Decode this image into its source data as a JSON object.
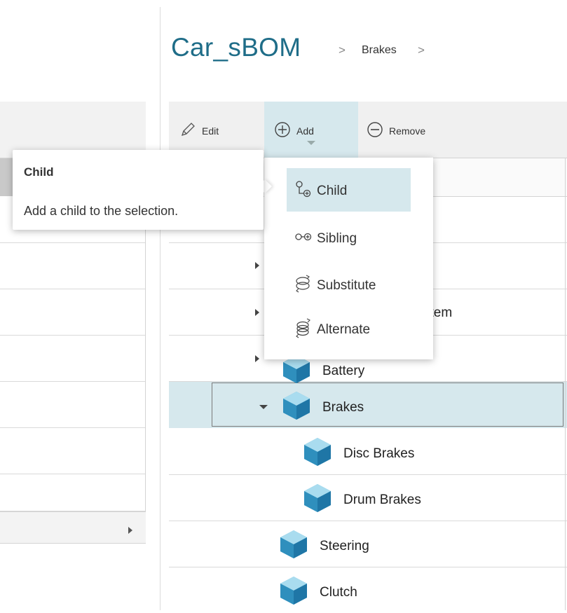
{
  "breadcrumb": {
    "root": "Car_sBOM",
    "separator": ">",
    "current": "Brakes"
  },
  "toolbar": {
    "edit_label": "Edit",
    "add_label": "Add",
    "remove_label": "Remove"
  },
  "tooltip": {
    "title": "Child",
    "description": "Add a child to the selection."
  },
  "add_menu": {
    "items": [
      {
        "label": "Child",
        "icon": "child-structure-icon",
        "highlighted": true
      },
      {
        "label": "Sibling",
        "icon": "sibling-structure-icon"
      },
      {
        "label": "Substitute",
        "icon": "substitute-icon"
      },
      {
        "label": "Alternate",
        "icon": "alternate-icon"
      }
    ]
  },
  "tree": {
    "rows": [
      {
        "label": "",
        "expander": "collapsed"
      },
      {
        "label": "stem",
        "expander": "collapsed"
      },
      {
        "label": "Battery",
        "expander": "collapsed"
      },
      {
        "label": "Brakes",
        "expander": "expanded",
        "selected": true
      },
      {
        "label": "Disc Brakes"
      },
      {
        "label": "Drum Brakes"
      },
      {
        "label": "Steering"
      },
      {
        "label": "Clutch"
      }
    ]
  },
  "colors": {
    "accent": "#1f6d88",
    "selection": "#d6e8ed",
    "cube": "#3aa3d0"
  }
}
